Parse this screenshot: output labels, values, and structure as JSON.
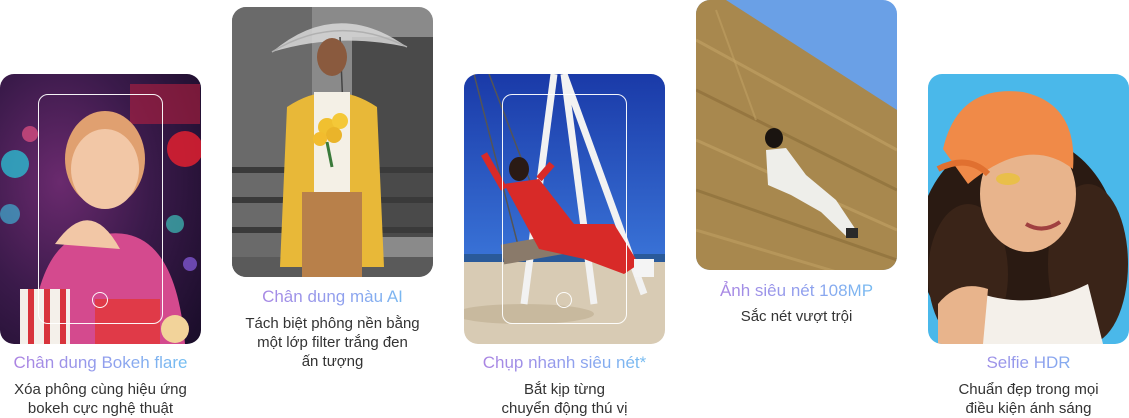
{
  "features": [
    {
      "title": "Chân dung Bokeh flare",
      "description_lines": [
        "Xóa phông cùng hiệu ứng",
        "bokeh cực nghệ thuật"
      ],
      "has_camera_frame": true
    },
    {
      "title": "Chân dung màu AI",
      "description_lines": [
        "Tách biệt phông nền bằng",
        "một lớp filter trắng đen",
        "ấn tượng"
      ],
      "has_camera_frame": false
    },
    {
      "title": "Chụp nhanh siêu nét*",
      "description_lines": [
        "Bắt kịp từng",
        "chuyển động thú vị"
      ],
      "has_camera_frame": true
    },
    {
      "title": "Ảnh siêu nét 108MP",
      "description_lines": [
        "Sắc nét vượt trội"
      ],
      "has_camera_frame": false
    },
    {
      "title": "Selfie HDR",
      "description_lines": [
        "Chuẩn đẹp trong mọi",
        "điều kiện ánh sáng"
      ],
      "has_camera_frame": false
    }
  ],
  "colors": {
    "title_gradient_start": "#b07fe0",
    "title_gradient_end": "#6fc4f2",
    "description_text": "#333333"
  }
}
